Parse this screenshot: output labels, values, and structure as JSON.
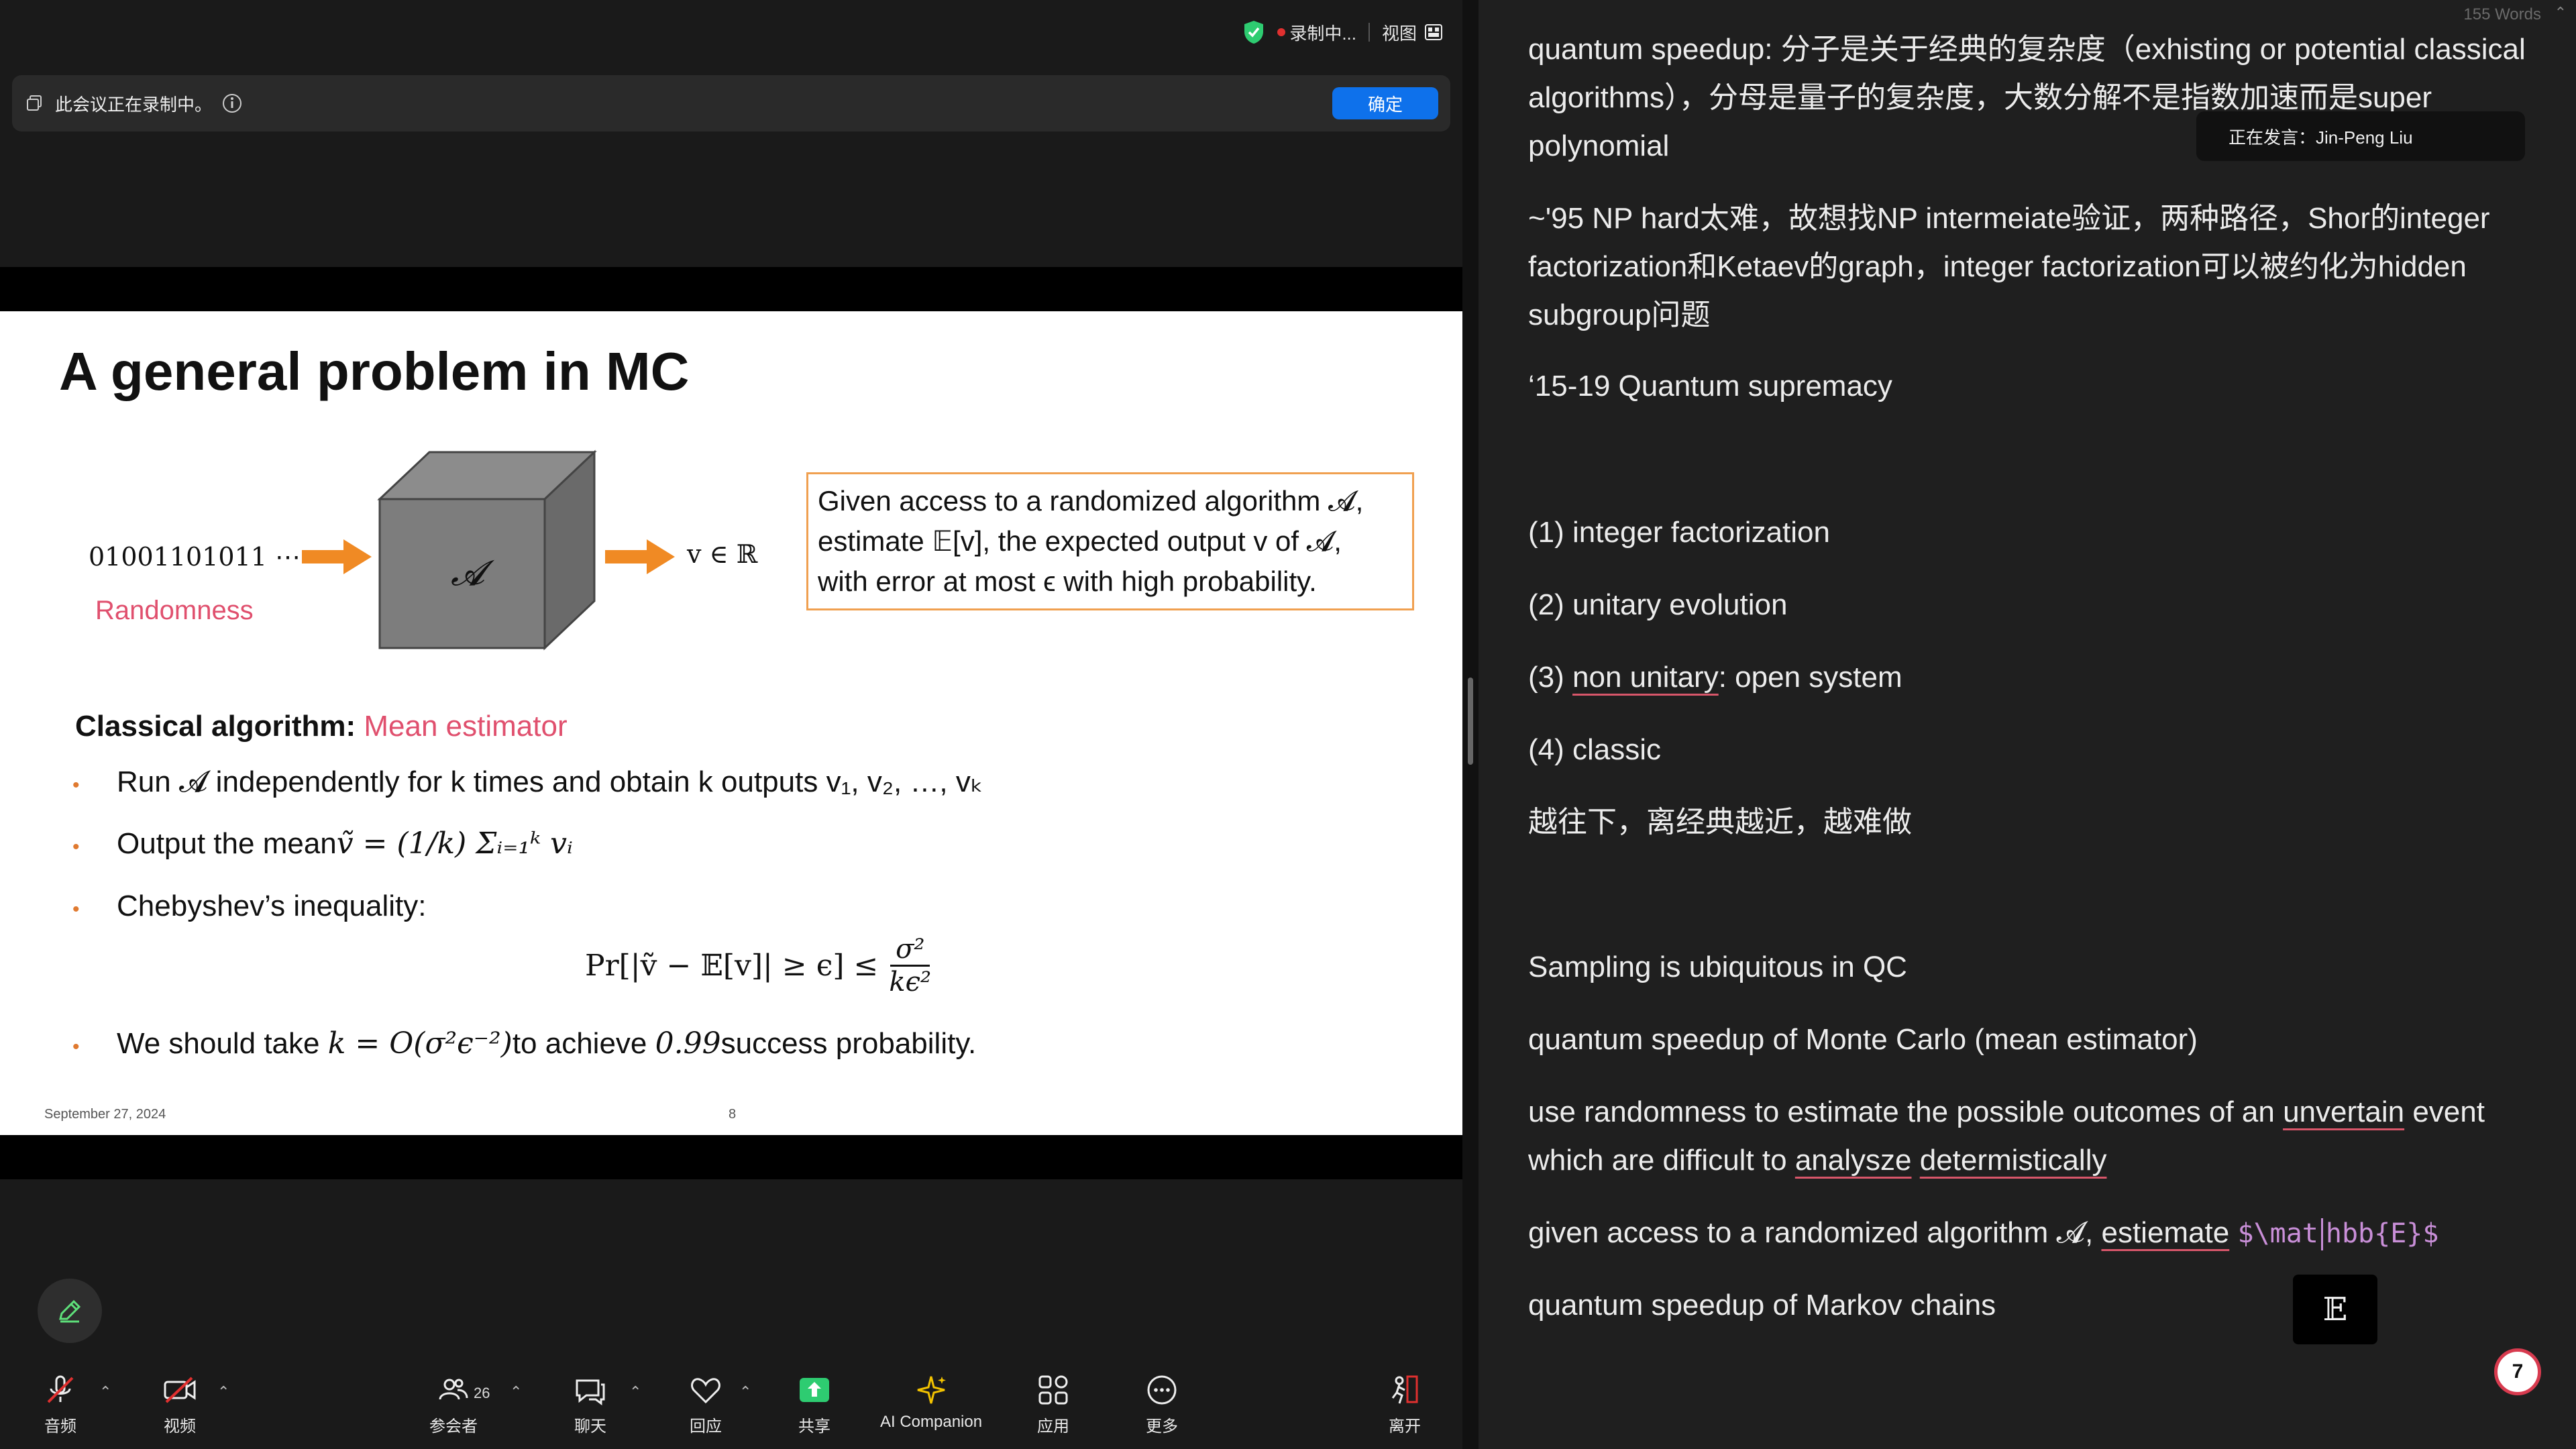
{
  "zoom": {
    "top_bar": {
      "recording_label": "录制中...",
      "view_label": "视图"
    },
    "recording_banner": {
      "text": "此会议正在录制中。",
      "ok_label": "确定"
    },
    "slide": {
      "title": "A general problem in MC",
      "input_bits": "01001101011 ⋯",
      "randomness_label": "Randomness",
      "cube_label": "𝓐",
      "output_label": "v ∈ ℝ",
      "given_lines": [
        "Given access to a randomized algorithm 𝓐,",
        "estimate 𝔼[v], the expected output v of 𝓐,",
        "with error at most ϵ with high probability."
      ],
      "classical_bold": "Classical algorithm:",
      "classical_pink": "Mean estimator",
      "bullet1": {
        "text": "Run 𝓐 independently for k times and obtain k outputs v₁, v₂, …, vₖ"
      },
      "bullet2": {
        "prefix": "Output the mean ",
        "math": "ṽ = (1/k) Σᵢ₌₁ᵏ vᵢ"
      },
      "bullet3": {
        "text": "Chebyshev’s inequality:"
      },
      "cheb_lhs": "Pr[|ṽ − 𝔼[v]| ≥ ϵ] ≤",
      "cheb_num": "σ²",
      "cheb_den": "kϵ²",
      "bullet4": {
        "prefix": "We should take ",
        "math1": "k = O(σ²ϵ⁻²)",
        "middle": " to achieve ",
        "math2": "0.99",
        "suffix": " success probability."
      },
      "date": "September 27, 2024",
      "page": "8"
    },
    "toolbar": {
      "audio": "音频",
      "video": "视频",
      "participants": "参会者",
      "participant_count": "26",
      "chat": "聊天",
      "react": "回应",
      "share": "共享",
      "ai": "AI Companion",
      "apps": "应用",
      "more": "更多",
      "leave": "离开"
    }
  },
  "notes": {
    "word_count": "155 Words",
    "speaker_tooltip": "正在发言：Jin-Peng Liu",
    "p1": "quantum speedup: 分子是关于经典的复杂度（exhisting or potential classical algorithms），分母是量子的复杂度，大数分解不是指数加速而是super polynomial",
    "p2": "~'95 NP hard太难，故想找NP intermeiate验证，两种路径，Shor的integer factorization和Ketaev的graph，integer factorization可以被约化为hidden subgroup问题",
    "p3": "‘15-19 Quantum supremacy",
    "p4": "(1) integer factorization",
    "p5": "(2) unitary evolution",
    "p6_prefix": "(3) ",
    "p6_u": "non unitary",
    "p6_suffix": ": open system",
    "p7": "(4) classic",
    "p8": "越往下，离经典越近，越难做",
    "p9": "Sampling is ubiquitous in QC",
    "p10": "quantum speedup of Monte Carlo (mean estimator)",
    "p11_a": "use randomness to estimate the possible outcomes of an ",
    "p11_u1": "unvertain",
    "p11_b": " event which are difficult to ",
    "p11_u2": "analysze",
    "p11_c": " ",
    "p11_u3": "determistically",
    "p12_a": "given access to a randomized algorithm 𝓐, ",
    "p12_u": "estiemate",
    "p12_code1": "$\\mat",
    "p12_code2": "hbb{E}$",
    "p13": "quantum speedup of Markov chains",
    "math_preview": "𝔼",
    "badge": "7"
  },
  "colors": {
    "accent": "#0e71eb",
    "pink": "#e0506e",
    "orange": "#f0a050",
    "underline": "#d8566a"
  }
}
